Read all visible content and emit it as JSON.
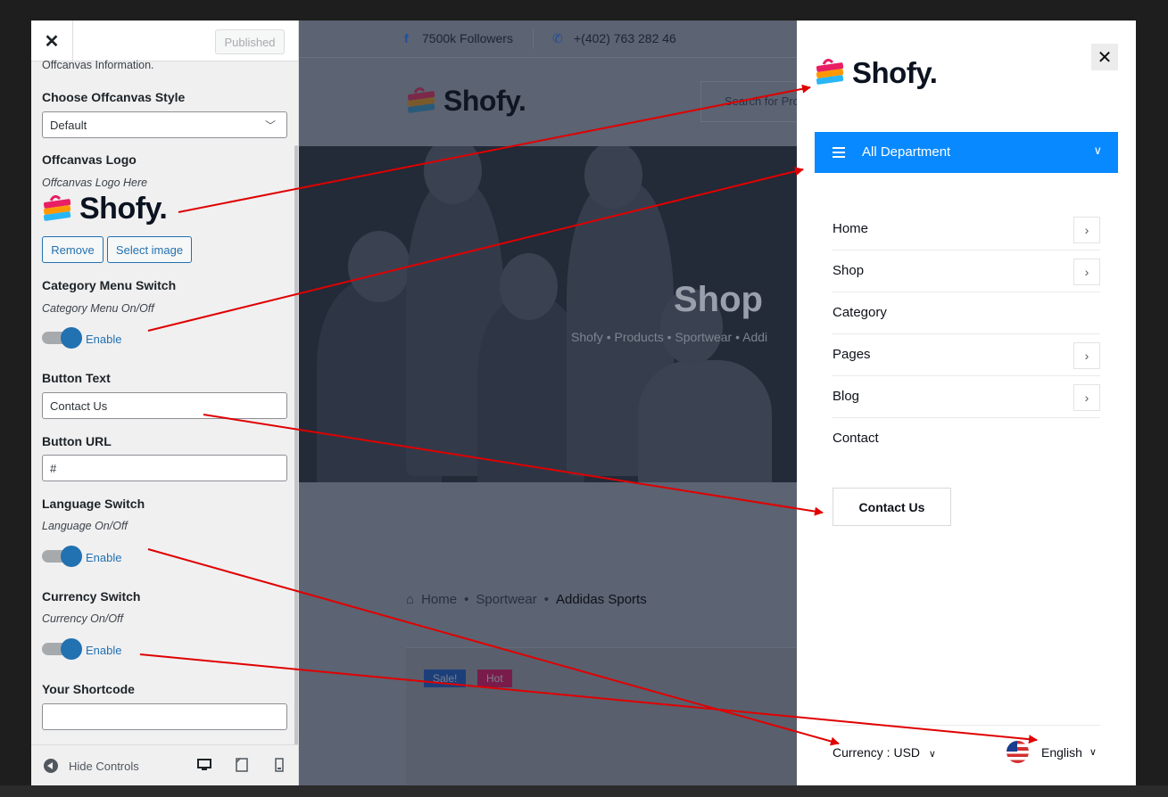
{
  "customizer": {
    "close_icon": "close-icon",
    "published_label": "Published",
    "section_intro": "Offcanvas Information.",
    "style_label": "Choose Offcanvas Style",
    "style_value": "Default",
    "logo_label": "Offcanvas Logo",
    "logo_hint": "Offcanvas Logo Here",
    "logo_text": "Shofy.",
    "remove_label": "Remove",
    "select_image_label": "Select image",
    "category_label": "Category Menu Switch",
    "category_hint": "Category Menu On/Off",
    "category_toggle": "Enable",
    "button_text_label": "Button Text",
    "button_text_value": "Contact Us",
    "button_url_label": "Button URL",
    "button_url_value": "#",
    "language_label": "Language Switch",
    "language_hint": "Language On/Off",
    "language_toggle": "Enable",
    "currency_label": "Currency Switch",
    "currency_hint": "Currency On/Off",
    "currency_toggle": "Enable",
    "shortcode_label": "Your Shortcode",
    "shortcode_value": "",
    "hide_controls": "Hide Controls",
    "devices": [
      "desktop-icon",
      "tablet-icon",
      "mobile-icon"
    ]
  },
  "preview": {
    "followers": "7500k Followers",
    "phone": "+(402) 763 282 46",
    "logo_text": "Shofy.",
    "search_placeholder": "Search for Pro",
    "hero_title": "Shop",
    "hero_breadcrumb": "Shofy  •  Products  •  Sportwear  •  Addi",
    "breadcrumb": [
      "Home",
      "Sportwear",
      "Addidas Sports"
    ],
    "badges": [
      "Sale!",
      "Hot"
    ]
  },
  "offcanvas": {
    "logo_text": "Shofy.",
    "department_label": "All Department",
    "menu": [
      {
        "label": "Home",
        "has_sub": true
      },
      {
        "label": "Shop",
        "has_sub": true
      },
      {
        "label": "Category",
        "has_sub": false
      },
      {
        "label": "Pages",
        "has_sub": true
      },
      {
        "label": "Blog",
        "has_sub": true
      },
      {
        "label": "Contact",
        "has_sub": false
      }
    ],
    "contact_button": "Contact Us",
    "currency": "Currency : USD",
    "language": "English"
  },
  "colors": {
    "accent_blue": "#0989ff",
    "wp_blue": "#2271b1",
    "arrow_red": "#e00000"
  }
}
